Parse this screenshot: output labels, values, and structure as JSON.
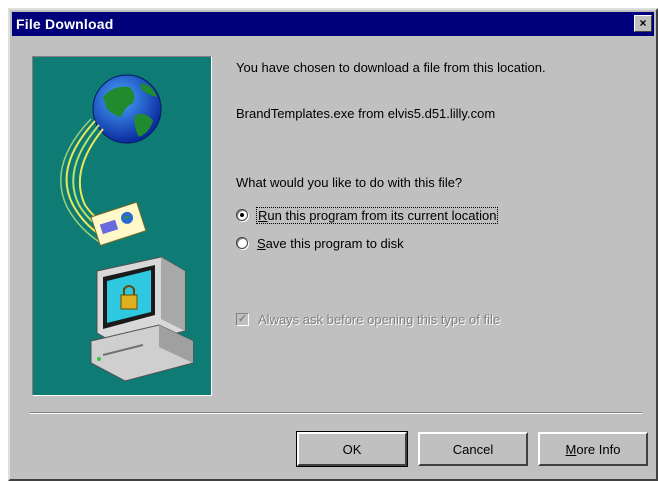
{
  "window": {
    "title": "File Download",
    "close_glyph": "×"
  },
  "illustration": {
    "icon": "download-globe-computer-illustration",
    "background_color": "#0e7b74"
  },
  "content": {
    "intro": "You have chosen to download a file from this location.",
    "file_location": "BrandTemplates.exe from elvis5.d51.lilly.com",
    "question": "What would you like to do with this file?"
  },
  "options": {
    "run": {
      "label_accel": "R",
      "label_rest": "un this program from its current location",
      "checked": true
    },
    "save": {
      "label_accel": "S",
      "label_rest": "ave this program to disk",
      "checked": false
    }
  },
  "always_ask": {
    "label": "Always ask before opening this type of file",
    "checked": true,
    "enabled": false
  },
  "buttons": {
    "ok": "OK",
    "cancel": "Cancel",
    "more_info_accel": "M",
    "more_info_rest": "ore Info"
  },
  "colors": {
    "titlebar": "#00007b",
    "face": "#c0c0c0"
  }
}
